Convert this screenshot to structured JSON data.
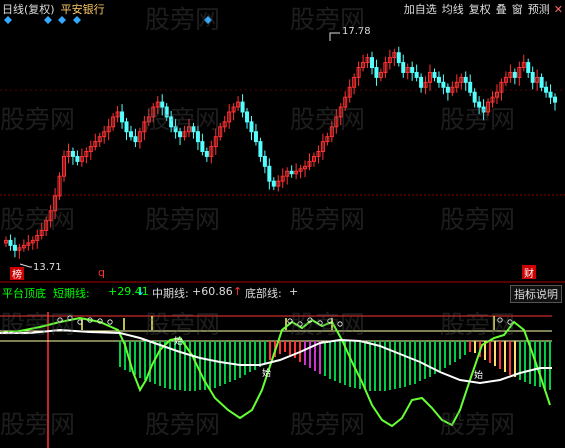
{
  "window": {
    "period_label": "日线(复权)",
    "stock_name": "平安银行",
    "menu": [
      "加自选",
      "均线",
      "复权",
      "叠",
      "窗",
      "预测"
    ],
    "close_icon": "close-icon"
  },
  "main_chart": {
    "high_label": "17.78",
    "low_label": "13.71",
    "marker_left": "榜",
    "marker_mid": "q",
    "marker_right": "财",
    "up_color": "#ff3333",
    "down_color": "#55ffff",
    "price_range": [
      13.2,
      18.2
    ]
  },
  "indicator": {
    "name": "平台顶底",
    "short_label": "短期线:",
    "short_value": "+29.41",
    "short_arrow": "↓",
    "mid_label": "中期线:",
    "mid_value": "+60.86",
    "mid_arrow": "↑",
    "bottom_label": "底部线:",
    "bottom_value": "+",
    "explain_button": "指标说明",
    "buy_label_1": "始",
    "buy_label_2": "始",
    "buy_label_3": "始"
  },
  "watermark_text": "股旁网"
}
